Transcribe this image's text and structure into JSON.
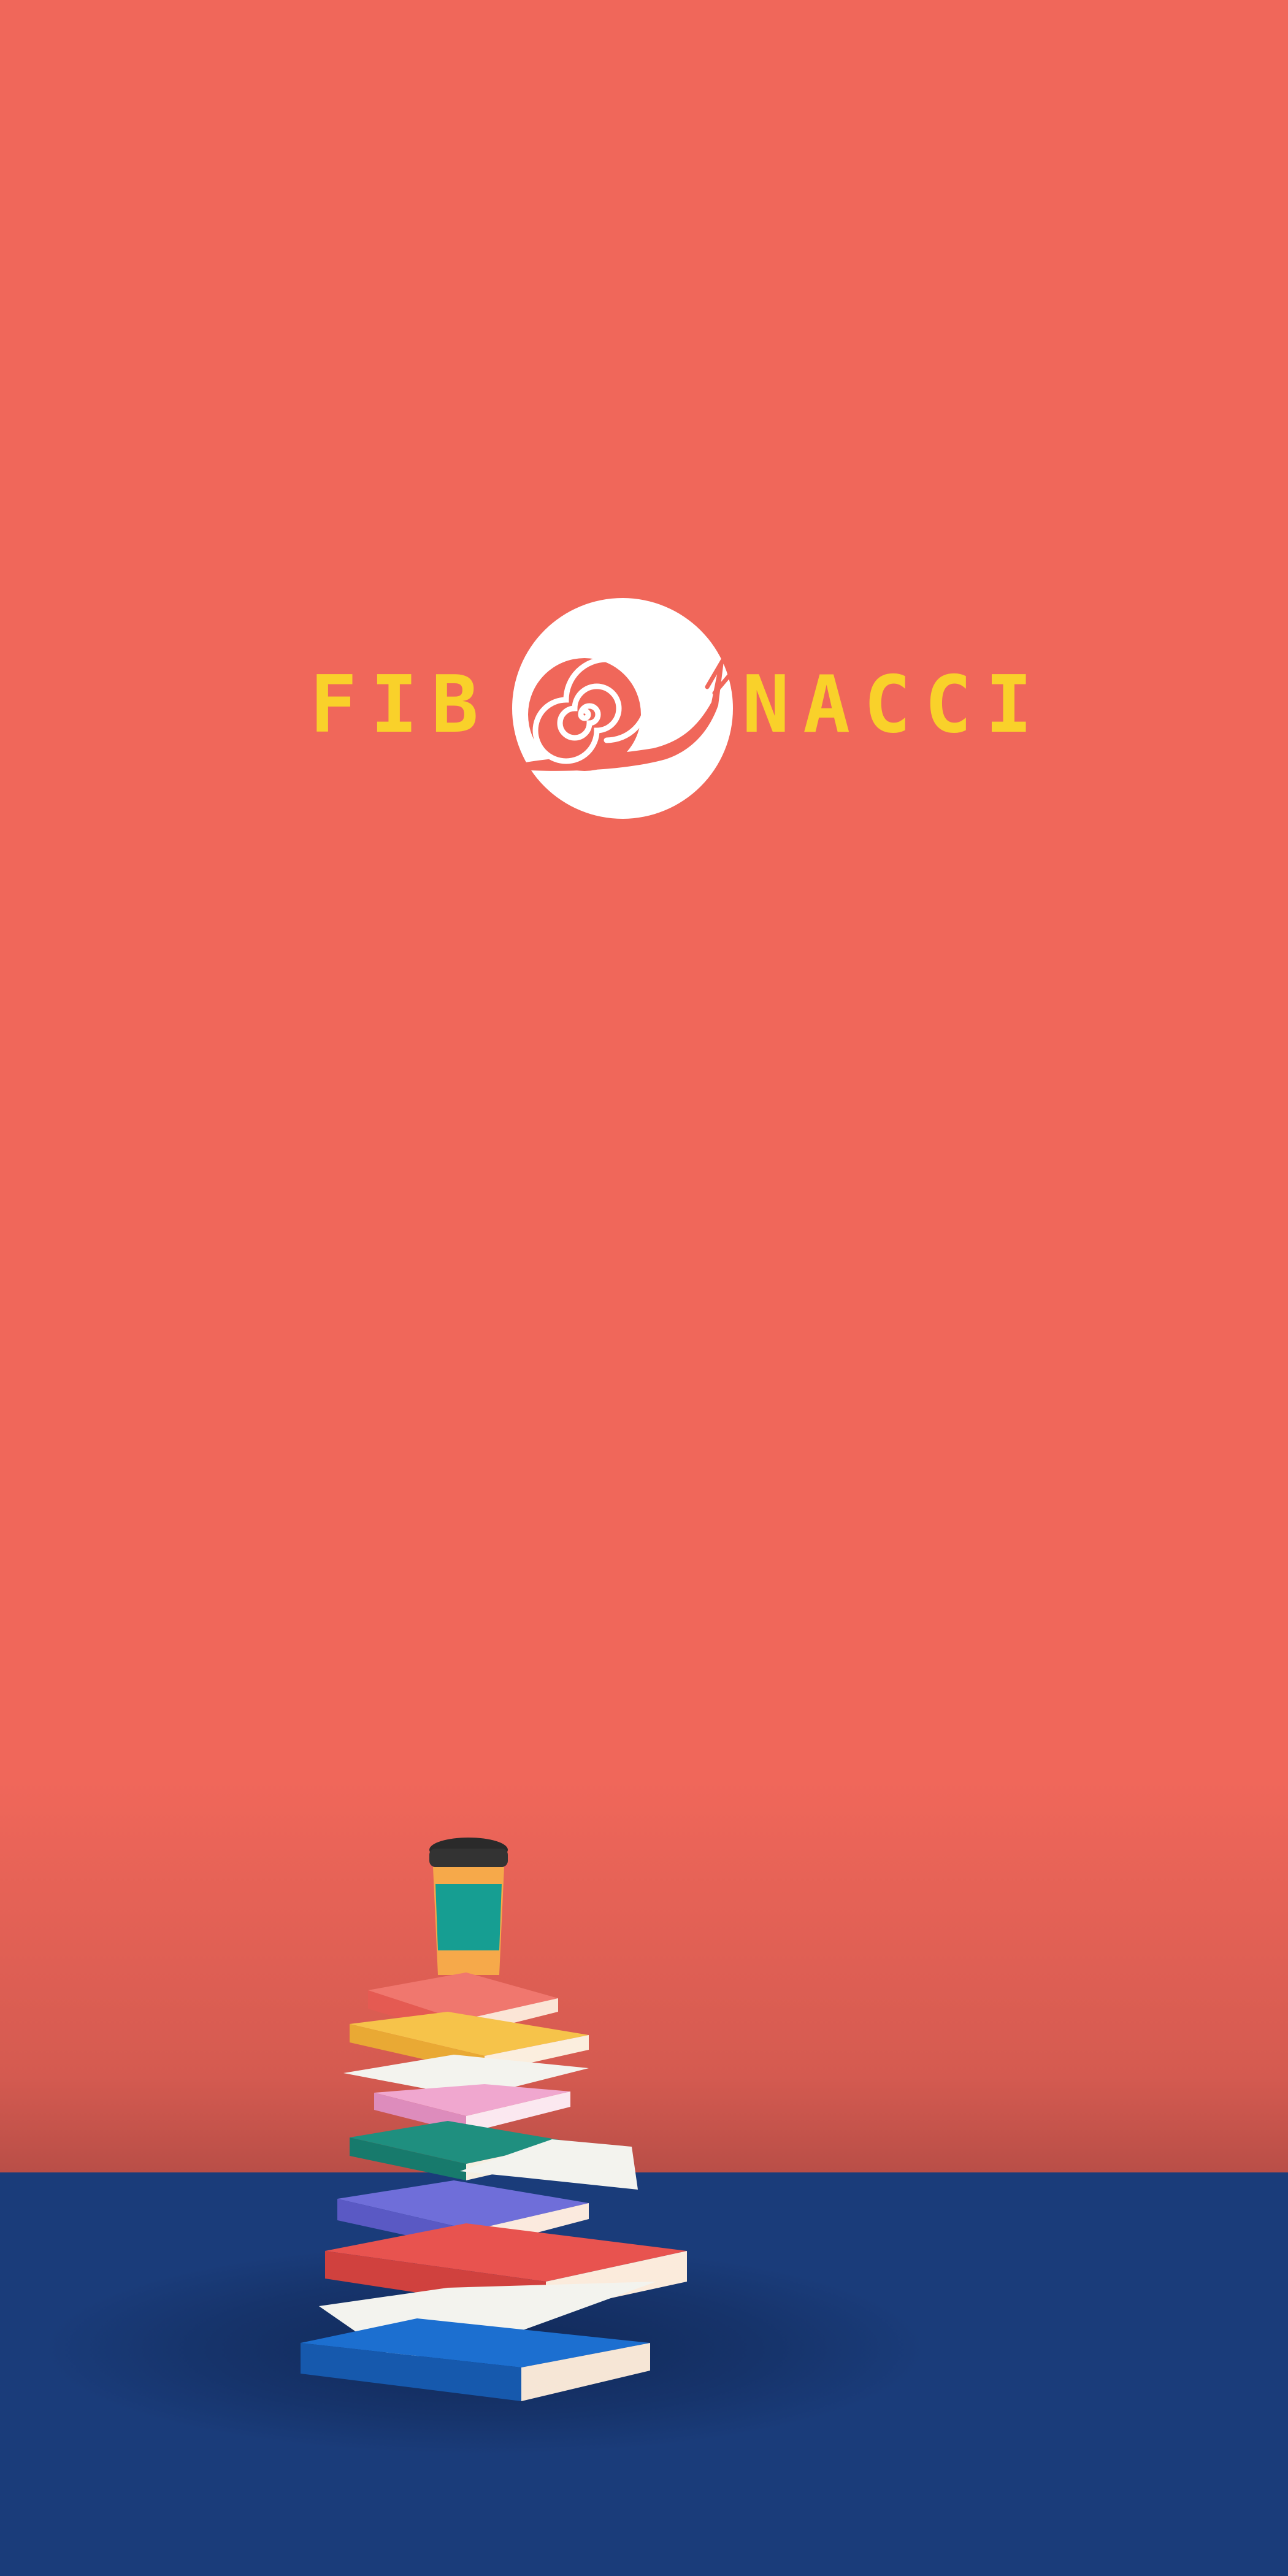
{
  "brand": {
    "name_left": "FIB",
    "name_right": "NACCI",
    "logo_icon": "snail-icon",
    "text_color": "#f9d12a",
    "mark_color": "#ffffff"
  },
  "colors": {
    "wall": "#f0675a",
    "floor": "#1a3c7a"
  },
  "illustration": {
    "icon": "stacked-books-coffee-icon"
  }
}
